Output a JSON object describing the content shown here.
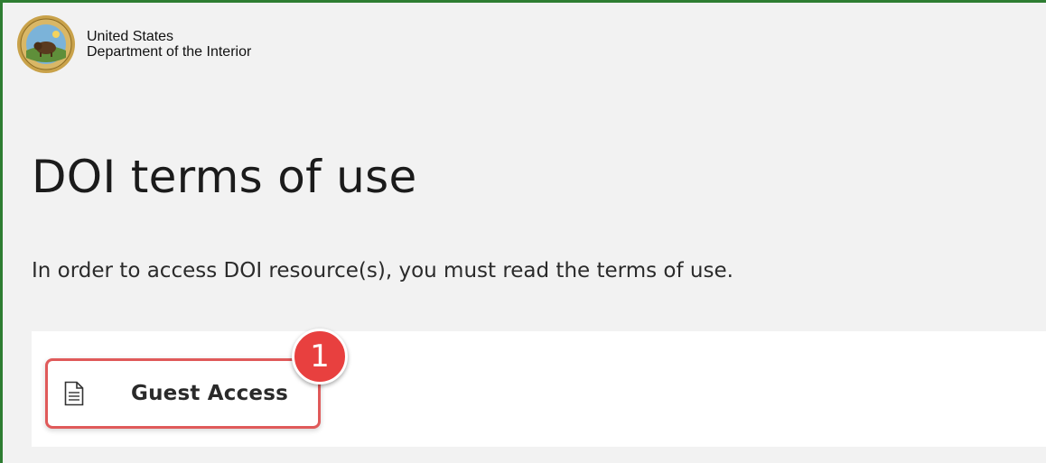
{
  "header": {
    "org_name_line1": "United States",
    "org_name_line2": "Department of the Interior",
    "seal_icon": "doi-seal-bison-icon"
  },
  "main": {
    "title": "DOI terms of use",
    "instruction": "In order to access DOI resource(s), you must read the terms of use.",
    "terms_items": [
      {
        "label": "Guest Access",
        "icon": "document-icon"
      }
    ]
  },
  "annotation": {
    "callout_number": "1",
    "color": "#e8403f"
  },
  "colors": {
    "frame_border": "#2e7d32",
    "background": "#f2f2f2",
    "highlight_border": "#e05a5a"
  }
}
